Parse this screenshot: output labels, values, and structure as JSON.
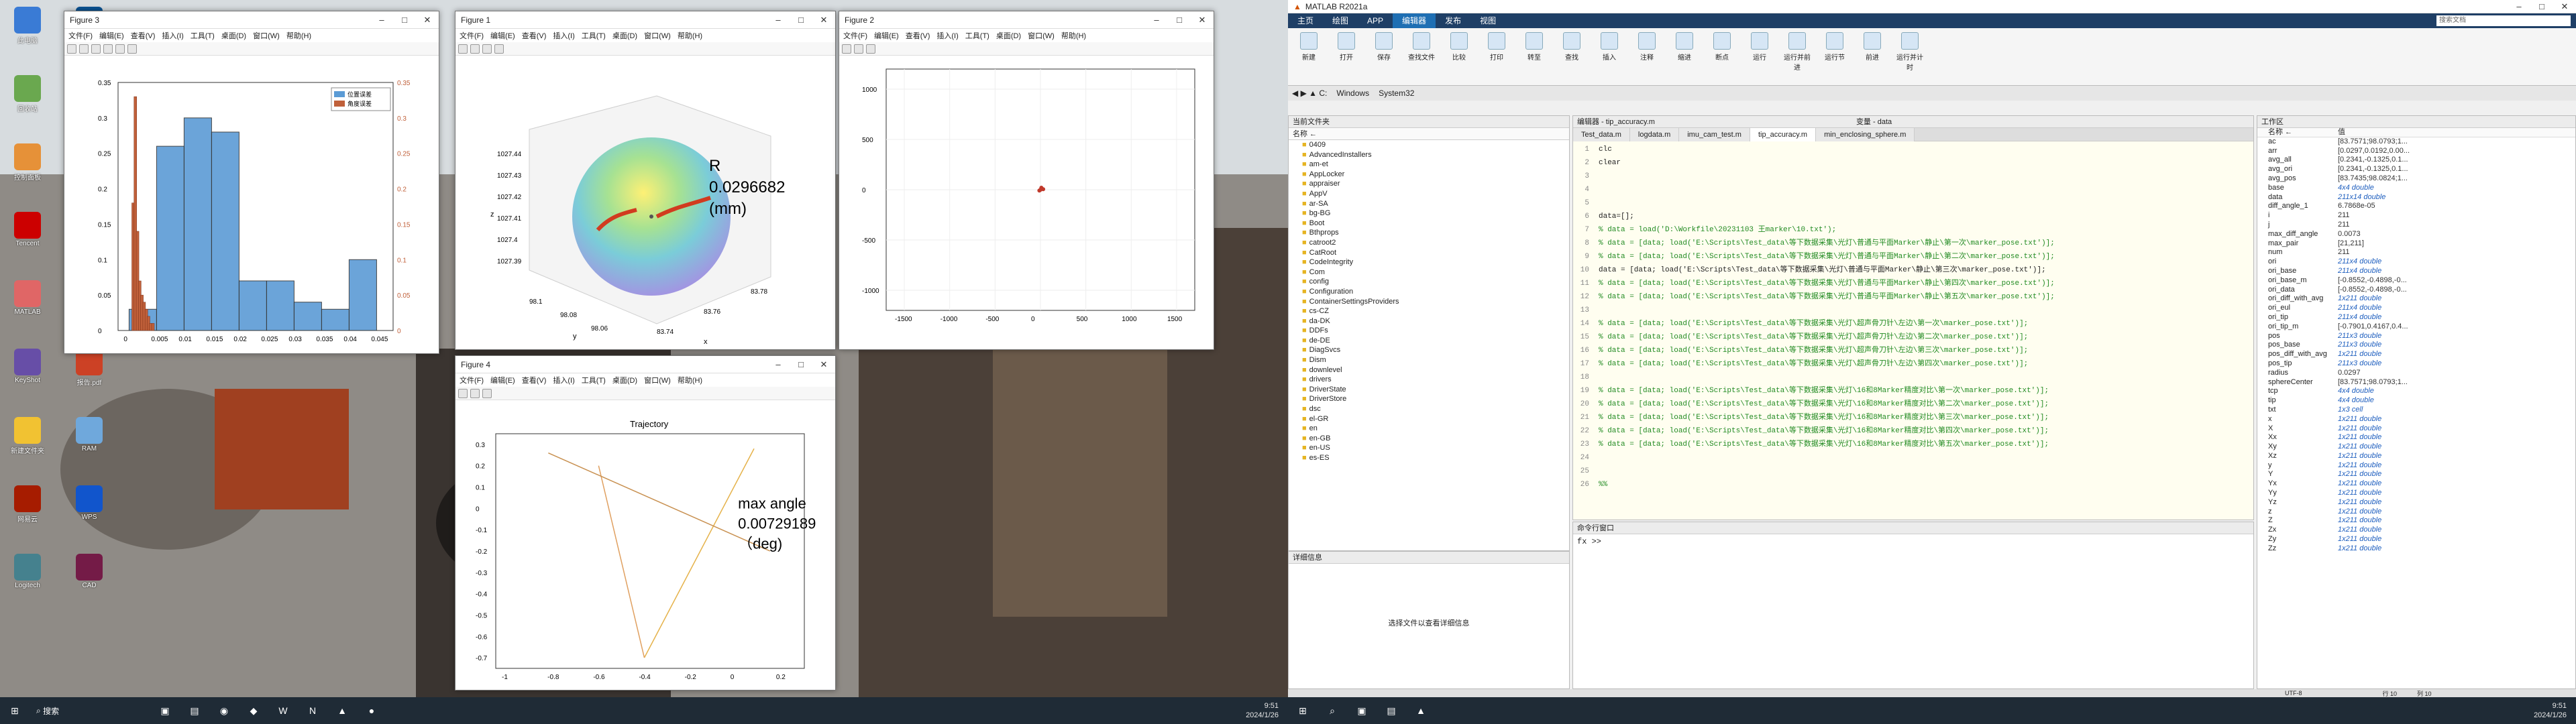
{
  "taskbar_left": {
    "search": "搜索",
    "clock_time": "9:51",
    "clock_date": "2024/1/26"
  },
  "taskbar_right": {
    "clock_time": "9:51",
    "clock_date": "2024/1/26"
  },
  "desktop_icons": [
    "此电脑",
    "回收站",
    "控制面板",
    "Tencent",
    "MATLAB",
    "KeyShot",
    "新建文件夹",
    "网易云",
    "Logitech",
    "VSCode",
    "飞书",
    "企业微信",
    "剪映",
    "ROBOT",
    "报告.pdf",
    "RAM",
    "WPS",
    "CAD"
  ],
  "fig3": {
    "title": "Figure 3",
    "menu": [
      "文件(F)",
      "编辑(E)",
      "查看(V)",
      "插入(I)",
      "工具(T)",
      "桌面(D)",
      "窗口(W)",
      "帮助(H)"
    ],
    "legend": [
      "位置误差",
      "角度误差"
    ],
    "xticks": [
      "0",
      "0.005",
      "0.01",
      "0.015",
      "0.02",
      "0.025",
      "0.03",
      "0.035",
      "0.04",
      "0.045"
    ],
    "ylticks": [
      "0.35",
      "0.3",
      "0.25",
      "0.2",
      "0.15",
      "0.1",
      "0.05",
      "0"
    ],
    "yrticks": [
      "0.35",
      "0.3",
      "0.25",
      "0.2",
      "0.15",
      "0.1",
      "0.05",
      "0"
    ]
  },
  "fig1": {
    "title": "Figure 1",
    "menu": [
      "文件(F)",
      "编辑(E)",
      "查看(V)",
      "插入(I)",
      "工具(T)",
      "桌面(D)",
      "窗口(W)",
      "帮助(H)"
    ],
    "zticks": [
      "1027.44",
      "1027.43",
      "1027.42",
      "1027.41",
      "1027.4",
      "1027.39"
    ],
    "zlabel": "z",
    "ylabel": "y",
    "xlabel": "x",
    "yticks": [
      "98.1",
      "98.08",
      "98.06"
    ],
    "xticks": [
      "83.74",
      "83.76",
      "83.78"
    ],
    "ann_label": "R",
    "ann_value": "0.0296682",
    "ann_unit": "(mm)"
  },
  "fig2": {
    "title": "Figure 2",
    "menu": [
      "文件(F)",
      "编辑(E)",
      "查看(V)",
      "插入(I)",
      "工具(T)",
      "桌面(D)",
      "窗口(W)",
      "帮助(H)"
    ],
    "yticks": [
      "1000",
      "500",
      "0",
      "-500",
      "-1000"
    ],
    "xticks": [
      "-1500",
      "-1000",
      "-500",
      "0",
      "500",
      "1000",
      "1500"
    ]
  },
  "fig4": {
    "title": "Figure 4",
    "menu": [
      "文件(F)",
      "编辑(E)",
      "查看(V)",
      "插入(I)",
      "工具(T)",
      "桌面(D)",
      "窗口(W)",
      "帮助(H)"
    ],
    "plot_title": "Trajectory",
    "yticks": [
      "0.3",
      "0.2",
      "0.1",
      "0",
      "-0.1",
      "-0.2",
      "-0.3",
      "-0.4",
      "-0.5",
      "-0.6",
      "-0.7"
    ],
    "xticks": [
      "-1",
      "-0.8",
      "-0.6",
      "-0.4",
      "-0.2",
      "0",
      "0.2"
    ],
    "ann_label": "max angle",
    "ann_value": "0.00729189",
    "ann_unit": "（deg)"
  },
  "matlab": {
    "title": "MATLAB R2021a",
    "tabs": [
      "主页",
      "绘图",
      "APP",
      "编辑器",
      "发布",
      "视图"
    ],
    "active_tab": "编辑器",
    "search_placeholder": "搜索文档",
    "ribbon": [
      "新建",
      "打开",
      "保存",
      "查找文件",
      "比较",
      "打印",
      "转至",
      "查找",
      "插入",
      "注释",
      "缩进",
      "断点",
      "运行",
      "运行并前进",
      "运行节",
      "前进",
      "运行并计时"
    ],
    "path": [
      "C:",
      "Windows",
      "System32"
    ],
    "files_title": "当前文件夹",
    "files_header": "名称 ←",
    "files": [
      "0409",
      "AdvancedInstallers",
      "am-et",
      "AppLocker",
      "appraiser",
      "AppV",
      "ar-SA",
      "bg-BG",
      "Boot",
      "Bthprops",
      "catroot2",
      "CatRoot",
      "CodeIntegrity",
      "Com",
      "config",
      "Configuration",
      "ContainerSettingsProviders",
      "cs-CZ",
      "da-DK",
      "DDFs",
      "de-DE",
      "DiagSvcs",
      "Dism",
      "downlevel",
      "drivers",
      "DriverState",
      "DriverStore",
      "dsc",
      "el-GR",
      "en",
      "en-GB",
      "en-US",
      "es-ES"
    ],
    "details_title": "详细信息",
    "details_hint": "选择文件以查看详细信息",
    "editor_title": "编辑器 - tip_accuracy.m",
    "vars_title": "变量 - data",
    "editor_tabs": [
      "Test_data.m",
      "logdata.m",
      "imu_cam_test.m",
      "tip_accuracy.m",
      "min_enclosing_sphere.m"
    ],
    "active_editor_tab": "tip_accuracy.m",
    "code": [
      {
        "n": "1",
        "t": "clc"
      },
      {
        "n": "2",
        "t": "clear"
      },
      {
        "n": "3",
        "t": ""
      },
      {
        "n": "4",
        "t": ""
      },
      {
        "n": "5",
        "t": ""
      },
      {
        "n": "6",
        "t": "data=[];"
      },
      {
        "n": "7",
        "t": "% data = load('D:\\Workfile\\20231103 王marker\\10.txt');"
      },
      {
        "n": "8",
        "t": "% data = [data; load('E:\\Scripts\\Test_data\\等下数据采集\\光灯\\普通与平面Marker\\静止\\第一次\\marker_pose.txt')];"
      },
      {
        "n": "9",
        "t": "% data = [data; load('E:\\Scripts\\Test_data\\等下数据采集\\光灯\\普通与平面Marker\\静止\\第二次\\marker_pose.txt')];"
      },
      {
        "n": "10",
        "t": "data = [data; load('E:\\Scripts\\Test_data\\等下数据采集\\光灯\\普通与平面Marker\\静止\\第三次\\marker_pose.txt')];"
      },
      {
        "n": "11",
        "t": "% data = [data; load('E:\\Scripts\\Test_data\\等下数据采集\\光灯\\普通与平面Marker\\静止\\第四次\\marker_pose.txt')];"
      },
      {
        "n": "12",
        "t": "% data = [data; load('E:\\Scripts\\Test_data\\等下数据采集\\光灯\\普通与平面Marker\\静止\\第五次\\marker_pose.txt')];"
      },
      {
        "n": "13",
        "t": ""
      },
      {
        "n": "14",
        "t": "% data = [data; load('E:\\Scripts\\Test_data\\等下数据采集\\光灯\\超声骨刀针\\左边\\第一次\\marker_pose.txt')];"
      },
      {
        "n": "15",
        "t": "% data = [data; load('E:\\Scripts\\Test_data\\等下数据采集\\光灯\\超声骨刀针\\左边\\第二次\\marker_pose.txt')];"
      },
      {
        "n": "16",
        "t": "% data = [data; load('E:\\Scripts\\Test_data\\等下数据采集\\光灯\\超声骨刀针\\左边\\第三次\\marker_pose.txt')];"
      },
      {
        "n": "17",
        "t": "% data = [data; load('E:\\Scripts\\Test_data\\等下数据采集\\光灯\\超声骨刀针\\左边\\第四次\\marker_pose.txt')];"
      },
      {
        "n": "18",
        "t": ""
      },
      {
        "n": "19",
        "t": "% data = [data; load('E:\\Scripts\\Test_data\\等下数据采集\\光灯\\16和8Marker精度对比\\第一次\\marker_pose.txt')];"
      },
      {
        "n": "20",
        "t": "% data = [data; load('E:\\Scripts\\Test_data\\等下数据采集\\光灯\\16和8Marker精度对比\\第二次\\marker_pose.txt')];"
      },
      {
        "n": "21",
        "t": "% data = [data; load('E:\\Scripts\\Test_data\\等下数据采集\\光灯\\16和8Marker精度对比\\第三次\\marker_pose.txt')];"
      },
      {
        "n": "22",
        "t": "% data = [data; load('E:\\Scripts\\Test_data\\等下数据采集\\光灯\\16和8Marker精度对比\\第四次\\marker_pose.txt')];"
      },
      {
        "n": "23",
        "t": "% data = [data; load('E:\\Scripts\\Test_data\\等下数据采集\\光灯\\16和8Marker精度对比\\第五次\\marker_pose.txt')];"
      },
      {
        "n": "24",
        "t": ""
      },
      {
        "n": "25",
        "t": ""
      },
      {
        "n": "26",
        "t": "%%"
      }
    ],
    "cmd_title": "命令行窗口",
    "cmd_prompt": "fx >>",
    "ws_title": "工作区",
    "ws_h_name": "名称 ←",
    "ws_h_value": "值",
    "ws": [
      {
        "n": "ac",
        "v": "[83.7571;98.0793;1..."
      },
      {
        "n": "arr",
        "v": "[0.0297,0.0192,0.00..."
      },
      {
        "n": "avg_all",
        "v": "[0.2341,-0.1325,0.1..."
      },
      {
        "n": "avg_ori",
        "v": "[0.2341,-0.1325,0.1..."
      },
      {
        "n": "avg_pos",
        "v": "[83.7435;98.0824;1..."
      },
      {
        "n": "base",
        "v": "4x4 double",
        "b": true
      },
      {
        "n": "data",
        "v": "211x14 double",
        "b": true
      },
      {
        "n": "diff_angle_1",
        "v": "6.7868e-05"
      },
      {
        "n": "i",
        "v": "211"
      },
      {
        "n": "j",
        "v": "211"
      },
      {
        "n": "max_diff_angle",
        "v": "0.0073"
      },
      {
        "n": "max_pair",
        "v": "[21,211]"
      },
      {
        "n": "num",
        "v": "211"
      },
      {
        "n": "ori",
        "v": "211x4 double",
        "b": true
      },
      {
        "n": "ori_base",
        "v": "211x4 double",
        "b": true
      },
      {
        "n": "ori_base_m",
        "v": "[-0.8552,-0.4898,-0..."
      },
      {
        "n": "ori_data",
        "v": "[-0.8552,-0.4898,-0..."
      },
      {
        "n": "ori_diff_with_avg",
        "v": "1x211 double",
        "b": true
      },
      {
        "n": "ori_eul",
        "v": "211x4 double",
        "b": true
      },
      {
        "n": "ori_tip",
        "v": "211x4 double",
        "b": true
      },
      {
        "n": "ori_tip_m",
        "v": "[-0.7901,0.4167,0.4..."
      },
      {
        "n": "pos",
        "v": "211x3 double",
        "b": true
      },
      {
        "n": "pos_base",
        "v": "211x3 double",
        "b": true
      },
      {
        "n": "pos_diff_with_avg",
        "v": "1x211 double",
        "b": true
      },
      {
        "n": "pos_tip",
        "v": "211x3 double",
        "b": true
      },
      {
        "n": "radius",
        "v": "0.0297"
      },
      {
        "n": "sphereCenter",
        "v": "[83.7571;98.0793;1..."
      },
      {
        "n": "tcp",
        "v": "4x4 double",
        "b": true
      },
      {
        "n": "tip",
        "v": "4x4 double",
        "b": true
      },
      {
        "n": "txt",
        "v": "1x3 cell",
        "b": true
      },
      {
        "n": "x",
        "v": "1x211 double",
        "b": true
      },
      {
        "n": "X",
        "v": "1x211 double",
        "b": true
      },
      {
        "n": "Xx",
        "v": "1x211 double",
        "b": true
      },
      {
        "n": "Xy",
        "v": "1x211 double",
        "b": true
      },
      {
        "n": "Xz",
        "v": "1x211 double",
        "b": true
      },
      {
        "n": "y",
        "v": "1x211 double",
        "b": true
      },
      {
        "n": "Y",
        "v": "1x211 double",
        "b": true
      },
      {
        "n": "Yx",
        "v": "1x211 double",
        "b": true
      },
      {
        "n": "Yy",
        "v": "1x211 double",
        "b": true
      },
      {
        "n": "Yz",
        "v": "1x211 double",
        "b": true
      },
      {
        "n": "z",
        "v": "1x211 double",
        "b": true
      },
      {
        "n": "Z",
        "v": "1x211 double",
        "b": true
      },
      {
        "n": "Zx",
        "v": "1x211 double",
        "b": true
      },
      {
        "n": "Zy",
        "v": "1x211 double",
        "b": true
      },
      {
        "n": "Zz",
        "v": "1x211 double",
        "b": true
      }
    ],
    "status_enc": "UTF-8",
    "status_pos": "行 10",
    "status_col": "列 10"
  },
  "colors": {
    "hist_blue": "#5b9bd5",
    "hist_red": "#c0603a",
    "accent": "#1f6fb3"
  },
  "chart_data": [
    {
      "type": "bar",
      "chart": "histogram",
      "series": [
        {
          "name": "位置误差",
          "values": [
            0.03,
            0.26,
            0.3,
            0.28,
            0.07,
            0.07,
            0.04,
            0.03,
            0.1
          ]
        },
        {
          "name": "角度误差",
          "values": [
            0.18,
            0.33,
            0.14,
            0.07,
            0.05,
            0.04,
            0.03,
            0.02,
            0.01,
            0.01
          ]
        }
      ],
      "x_bins_blue": [
        0.0,
        0.005,
        0.01,
        0.015,
        0.02,
        0.025,
        0.03,
        0.035,
        0.04,
        0.045
      ],
      "xlim": [
        -0.002,
        0.048
      ],
      "ylim": [
        0,
        0.35
      ]
    },
    {
      "type": "scatter",
      "chart": "3d-sphere",
      "annotation": "R 0.0296682 (mm)"
    },
    {
      "type": "scatter",
      "xlim": [
        -1700,
        1700
      ],
      "ylim": [
        -1200,
        1200
      ],
      "points": [
        [
          0,
          0
        ],
        [
          10,
          20
        ],
        [
          -12,
          -8
        ],
        [
          30,
          5
        ]
      ]
    },
    {
      "type": "line",
      "title": "Trajectory",
      "xlim": [
        -1.05,
        0.3
      ],
      "ylim": [
        -0.75,
        0.35
      ],
      "segments": [
        [
          [
            -0.4,
            -0.7
          ],
          [
            0.08,
            0.28
          ]
        ],
        [
          [
            -0.4,
            -0.7
          ],
          [
            -0.6,
            0.2
          ]
        ],
        [
          [
            0.15,
            -0.2
          ],
          [
            -0.82,
            0.26
          ]
        ]
      ],
      "annotation": "max angle 0.00729189 (deg)"
    }
  ]
}
